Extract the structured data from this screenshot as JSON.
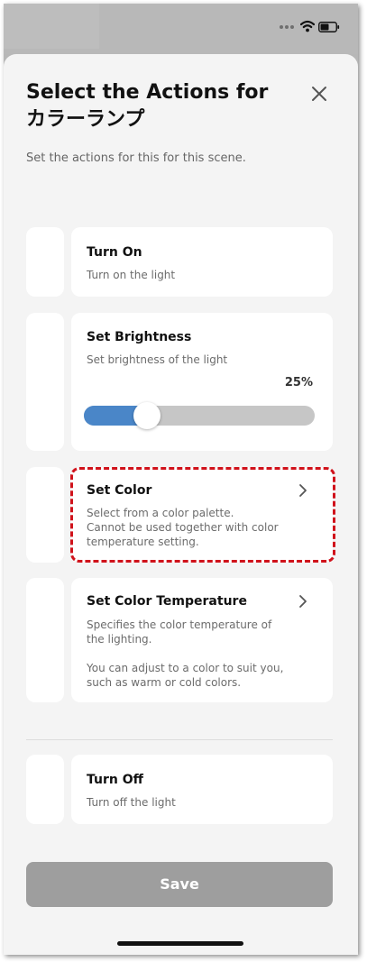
{
  "sheet": {
    "title": "Select the Actions for\nカラーランプ",
    "subtitle": "Set the actions for this for this scene."
  },
  "actions": [
    {
      "title": "Turn On",
      "description": "Turn on the light"
    },
    {
      "title": "Set Brightness",
      "description": "Set brightness of the light",
      "value_label": "25%",
      "value": 0.25
    },
    {
      "title": "Set Color",
      "description": "Select from a color palette.\n Cannot be used together with color\ntemperature setting."
    },
    {
      "title": "Set Color Temperature",
      "description": "Specifies the color temperature of\nthe lighting.\n\nYou can adjust to a color to suit you,\nsuch as warm or cold colors."
    },
    {
      "title": "Turn Off",
      "description": "Turn off the light"
    }
  ],
  "save_label": "Save",
  "colors": {
    "slider_fill": "#4a86c8",
    "highlight": "#d0121b",
    "save_button": "#9e9e9e"
  },
  "icons": [
    "signal-dots-icon",
    "wifi-icon",
    "battery-icon",
    "close-icon",
    "chevron-right-icon"
  ]
}
